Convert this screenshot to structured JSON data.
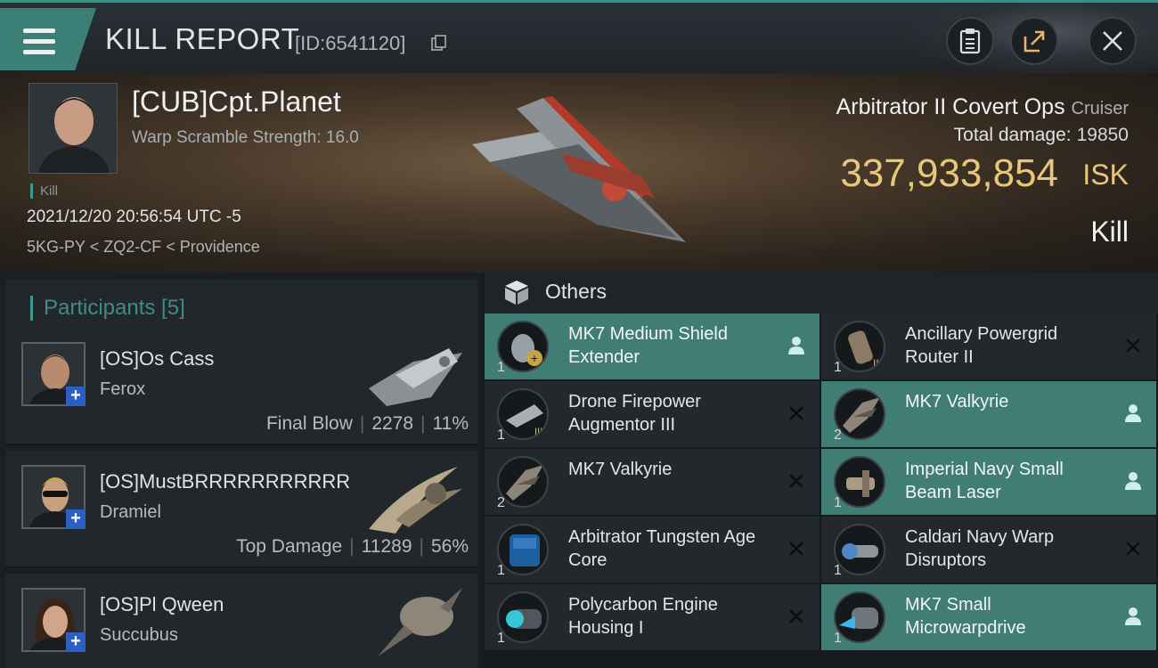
{
  "header": {
    "title": "KILL REPORT",
    "report_id": "[ID:6541120]"
  },
  "victim": {
    "name": "[CUB]Cpt.Planet",
    "scramble": "Warp Scramble Strength: 16.0",
    "tag": "Kill",
    "timestamp": "2021/12/20 20:56:54 UTC -5",
    "location": "5KG-PY < ZQ2-CF < Providence",
    "ship": "Arbitrator II Covert Ops",
    "ship_class": "Cruiser",
    "total_damage_label": "Total damage:",
    "total_damage": "19850",
    "isk_value": "337,933,854",
    "isk_unit": "ISK",
    "outcome": "Kill"
  },
  "participants": {
    "title": "Participants [5]",
    "list": [
      {
        "name": "[OS]Os Cass",
        "ship": "Ferox",
        "role": "Final Blow",
        "damage": "2278",
        "percent": "11%"
      },
      {
        "name": "[OS]MustBRRRRRRRRRRR",
        "ship": "Dramiel",
        "role": "Top Damage",
        "damage": "11289",
        "percent": "56%"
      },
      {
        "name": "[OS]Pl Qween",
        "ship": "Succubus",
        "role": "",
        "damage": "",
        "percent": ""
      }
    ]
  },
  "others": {
    "title": "Others",
    "items": [
      {
        "name": "MK7 Medium Shield Extender",
        "qty": "1",
        "dropped": true,
        "icon": "shield-extender-icon"
      },
      {
        "name": "Ancillary Powergrid Router II",
        "qty": "1",
        "dropped": false,
        "icon": "powergrid-router-icon"
      },
      {
        "name": "Drone Firepower Augmentor III",
        "qty": "1",
        "dropped": false,
        "icon": "drone-augmentor-icon"
      },
      {
        "name": "MK7  Valkyrie",
        "qty": "2",
        "dropped": true,
        "icon": "drone-icon"
      },
      {
        "name": "MK7  Valkyrie",
        "qty": "2",
        "dropped": false,
        "icon": "drone-icon"
      },
      {
        "name": "Imperial Navy Small Beam Laser",
        "qty": "1",
        "dropped": true,
        "icon": "laser-icon"
      },
      {
        "name": "Arbitrator Tungsten Age Core",
        "qty": "1",
        "dropped": false,
        "icon": "core-icon"
      },
      {
        "name": "Caldari Navy Warp Disruptors",
        "qty": "1",
        "dropped": false,
        "icon": "warp-disruptor-icon"
      },
      {
        "name": "Polycarbon Engine Housing I",
        "qty": "1",
        "dropped": false,
        "icon": "engine-housing-icon"
      },
      {
        "name": "MK7 Small Microwarpdrive",
        "qty": "1",
        "dropped": true,
        "icon": "microwarpdrive-icon"
      }
    ]
  },
  "colors": {
    "accent": "#3d9a8f",
    "dropped": "#3f7d75",
    "isk": "#e8c77c",
    "plus_badge": "#2a5fc4"
  }
}
